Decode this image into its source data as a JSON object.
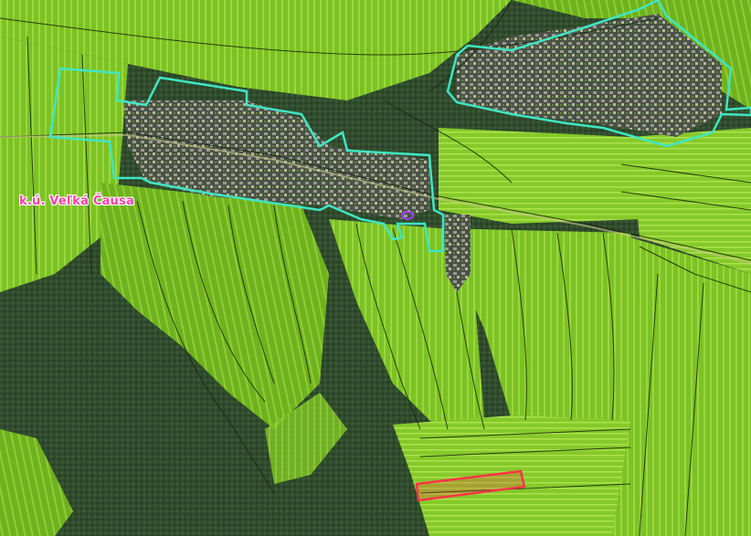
{
  "map": {
    "cadastral_area_label": "k.ú. Veľká Čausa",
    "colors": {
      "forest": "#2f4a2c",
      "field_bright": "#8fd12a",
      "field_mid": "#6fb21f",
      "field_dark": "#4f7f1c",
      "settlement": "#454b42",
      "parcel_line": "#16260e",
      "intravilan_boundary": "#3fe6c4",
      "highlighted_parcel": "#ff3347",
      "small_marker": "#a640ff",
      "label_text": "#ff3fa6",
      "label_halo": "#ffffff"
    },
    "layers": [
      "orthophoto",
      "parcel-boundaries",
      "intravilan-boundary",
      "highlighted-parcel",
      "cadastral-area-label"
    ]
  }
}
